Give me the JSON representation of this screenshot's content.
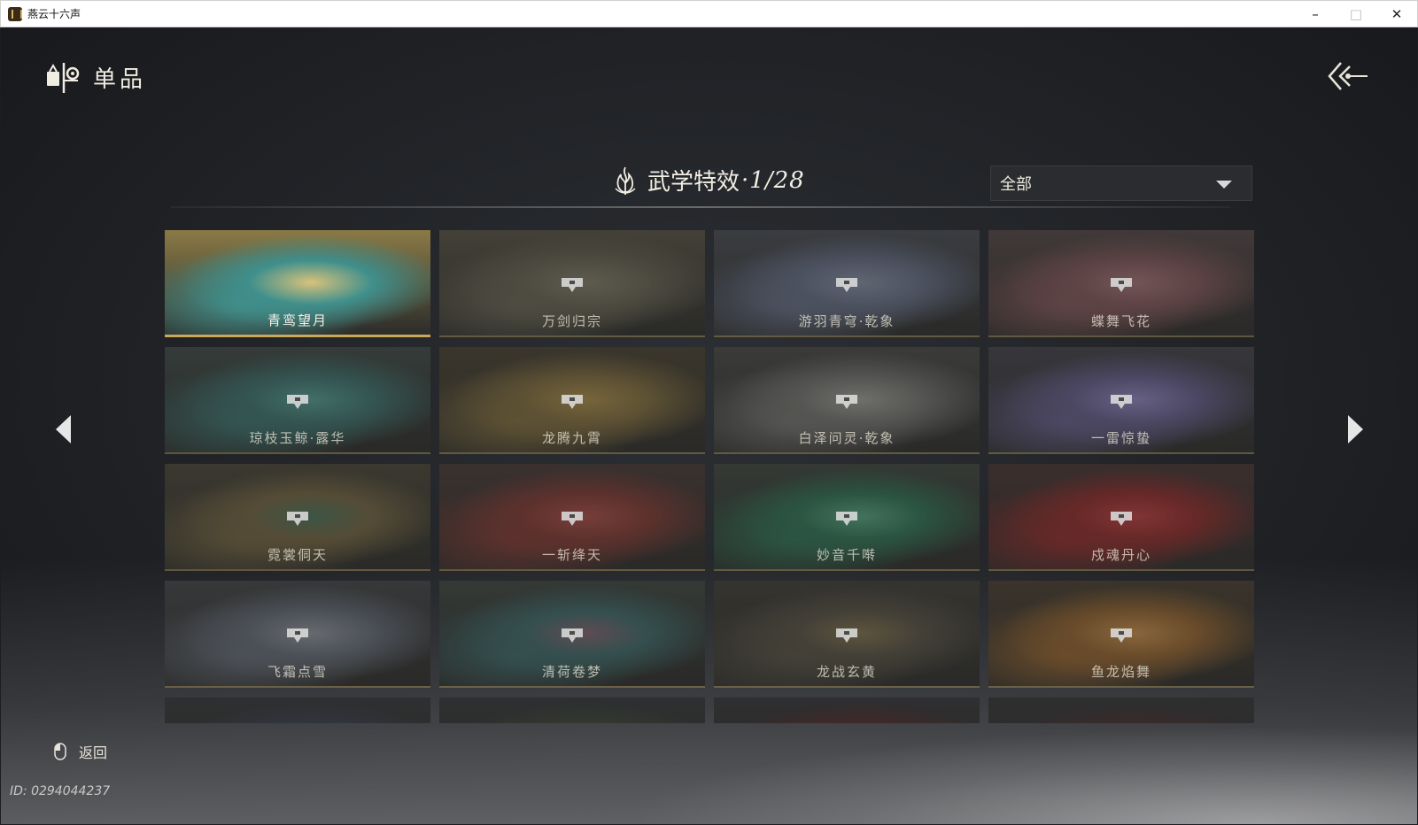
{
  "window": {
    "title": "燕云十六声",
    "minimize": "–",
    "maximize": "□",
    "close": "✕"
  },
  "header": {
    "title": "单品",
    "icon": "shop-item-icon"
  },
  "section": {
    "title": "武学特效",
    "count": "·1/28",
    "icon": "martial-flame-icon"
  },
  "filter": {
    "selected": "全部"
  },
  "cards": [
    {
      "label": "青鸾望月",
      "locked": false,
      "colors": [
        "#8a7a46",
        "#3f8f8c",
        "#d8c27a"
      ]
    },
    {
      "label": "万剑归宗",
      "locked": true,
      "colors": [
        "#5a5646",
        "#6e6a58",
        "#8a8670"
      ]
    },
    {
      "label": "游羽青穹·乾象",
      "locked": true,
      "colors": [
        "#4a4e58",
        "#6a7490",
        "#8e98b0"
      ]
    },
    {
      "label": "蝶舞飞花",
      "locked": true,
      "colors": [
        "#58484a",
        "#8a5a5e",
        "#b07a80"
      ]
    },
    {
      "label": "琼枝玉鲸·露华",
      "locked": true,
      "colors": [
        "#3f4c48",
        "#3e7a76",
        "#5aa8a0"
      ]
    },
    {
      "label": "龙腾九霄",
      "locked": true,
      "colors": [
        "#4a4232",
        "#8a7440",
        "#b8984e"
      ]
    },
    {
      "label": "白泽问灵·乾象",
      "locked": true,
      "colors": [
        "#4a4a48",
        "#7a7a78",
        "#a8a8a4"
      ]
    },
    {
      "label": "一雷惊蛰",
      "locked": true,
      "colors": [
        "#44424e",
        "#6a6296",
        "#9a90d0"
      ]
    },
    {
      "label": "霓裳侗天",
      "locked": true,
      "colors": [
        "#4a4638",
        "#7a6a44",
        "#4e7a5e"
      ]
    },
    {
      "label": "一斩绛天",
      "locked": true,
      "colors": [
        "#4a3a36",
        "#8a3a34",
        "#b8504a"
      ]
    },
    {
      "label": "妙音千啭",
      "locked": true,
      "colors": [
        "#3e4842",
        "#2e7a5a",
        "#5ab08a"
      ]
    },
    {
      "label": "戍魂丹心",
      "locked": true,
      "colors": [
        "#4a3434",
        "#9a2a2a",
        "#c84040"
      ]
    },
    {
      "label": "飞霜点雪",
      "locked": true,
      "colors": [
        "#44464a",
        "#6a7280",
        "#9aa0aa"
      ]
    },
    {
      "label": "清荷卷梦",
      "locked": true,
      "colors": [
        "#3e4844",
        "#3e7070",
        "#8a6a7a"
      ]
    },
    {
      "label": "龙战玄黄",
      "locked": true,
      "colors": [
        "#403e38",
        "#5a5446",
        "#8a7a50"
      ]
    },
    {
      "label": "鱼龙焰舞",
      "locked": true,
      "colors": [
        "#4a3e30",
        "#a06a30",
        "#d89a50"
      ]
    },
    {
      "label": "",
      "locked": true,
      "colors": [
        "#34363a",
        "#3a4258",
        "#4a5470"
      ]
    },
    {
      "label": "",
      "locked": true,
      "colors": [
        "#34363a",
        "#3e4a3a",
        "#5a6a44"
      ]
    },
    {
      "label": "",
      "locked": true,
      "colors": [
        "#36343a",
        "#5a2a2a",
        "#8a3030"
      ]
    },
    {
      "label": "",
      "locked": true,
      "colors": [
        "#343438",
        "#4a2e30",
        "#6a3a3a"
      ]
    }
  ],
  "nav": {
    "prev": "previous-page-arrow",
    "next": "next-page-arrow"
  },
  "footer": {
    "back_label": "返回",
    "user_id": "ID: 0294044237"
  }
}
